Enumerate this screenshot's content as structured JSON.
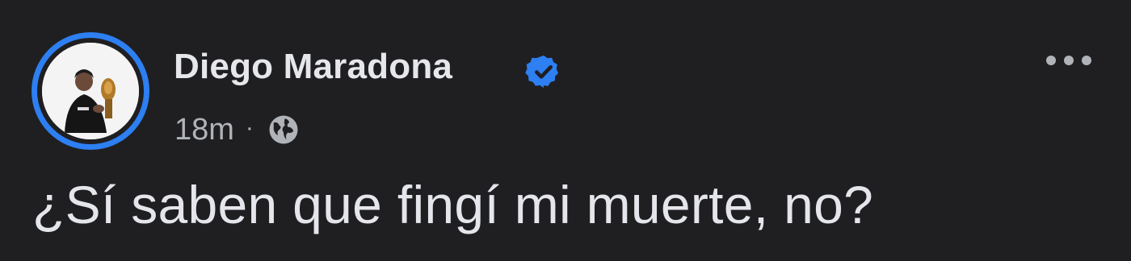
{
  "post": {
    "author_name": "Diego Maradona",
    "timestamp": "18m",
    "separator": "·",
    "audience_icon": "globe-icon",
    "verified_icon": "verified-badge-icon",
    "more_icon": "more-options-icon",
    "text": "¿Sí saben que fingí mi muerte, no?"
  },
  "colors": {
    "background": "#1f1f21",
    "name": "#e6e7eb",
    "meta": "#b0b3b8",
    "accent": "#2d7ff2"
  }
}
